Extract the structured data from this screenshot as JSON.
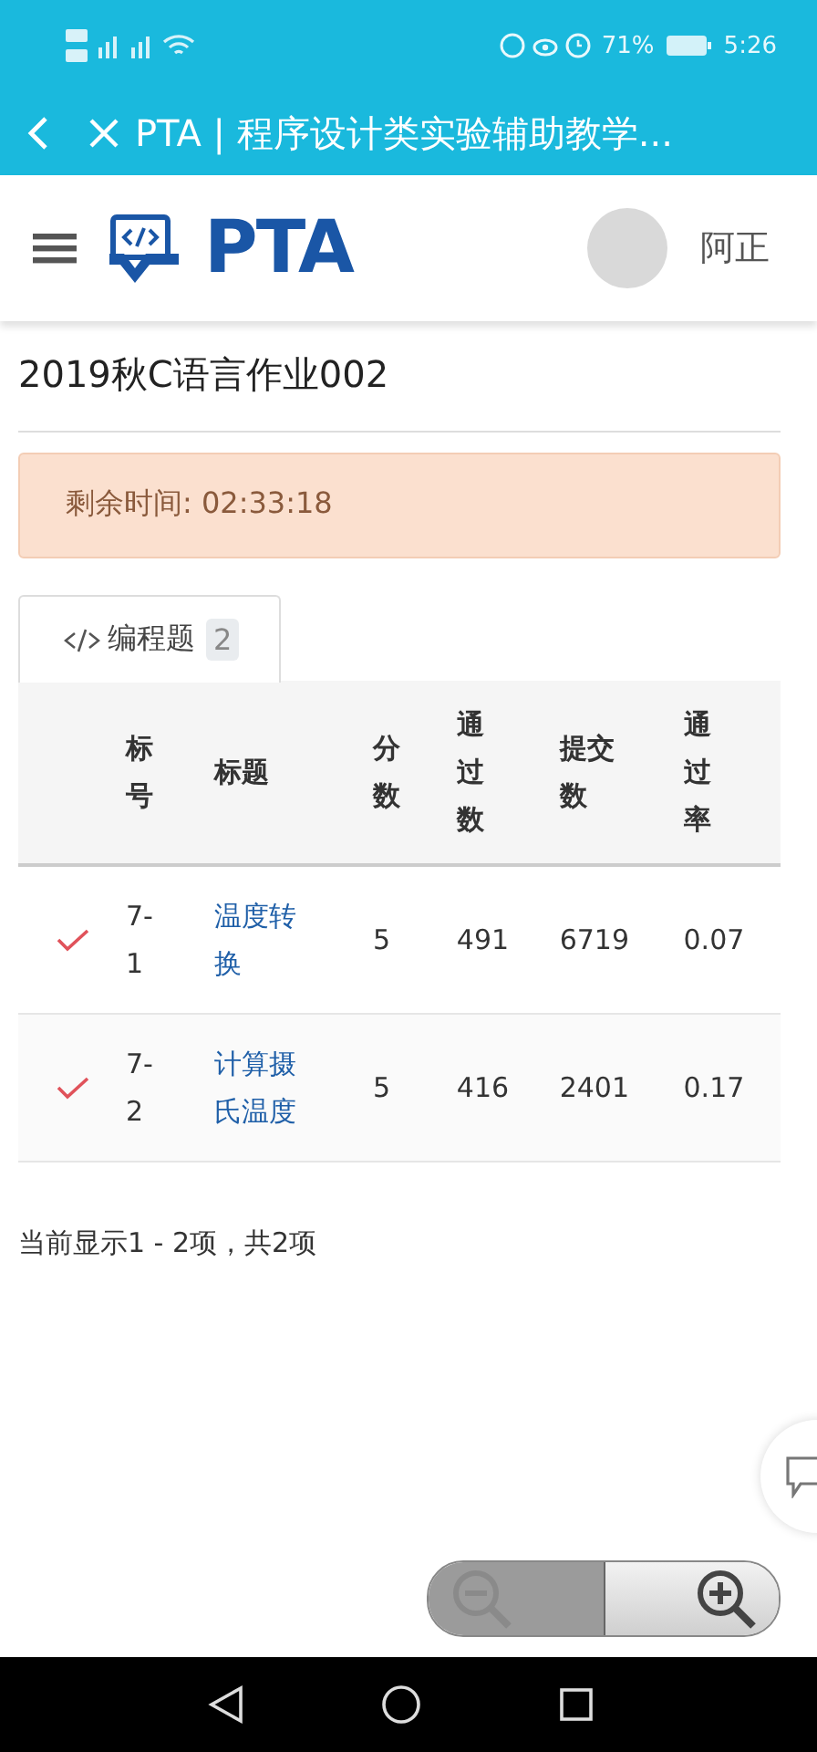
{
  "status_bar": {
    "battery": "71%",
    "time": "5:26"
  },
  "browser_bar": {
    "title": "PTA | 程序设计类实验辅助教学..."
  },
  "header": {
    "logo": "PTA",
    "user": "阿正"
  },
  "page_title": "2019秋C语言作业002",
  "timer": {
    "label": "剩余时间: 02:33:18"
  },
  "tabs": [
    {
      "label": "编程题",
      "count": "2",
      "selected": true
    }
  ],
  "table": {
    "columns": [
      "标号",
      "标题",
      "分数",
      "通过数",
      "提交数",
      "通过率"
    ],
    "rows": [
      {
        "solved": true,
        "cells": [
          "7-1",
          "温度转换",
          "5",
          "491",
          "6719",
          "0.07"
        ]
      },
      {
        "solved": true,
        "cells": [
          "7-2",
          "计算摄氏温度",
          "5",
          "416",
          "2401",
          "0.17"
        ]
      }
    ]
  },
  "footer": "当前显示1 - 2项，共2项",
  "zoom": {
    "zoom_out_disabled": true
  }
}
